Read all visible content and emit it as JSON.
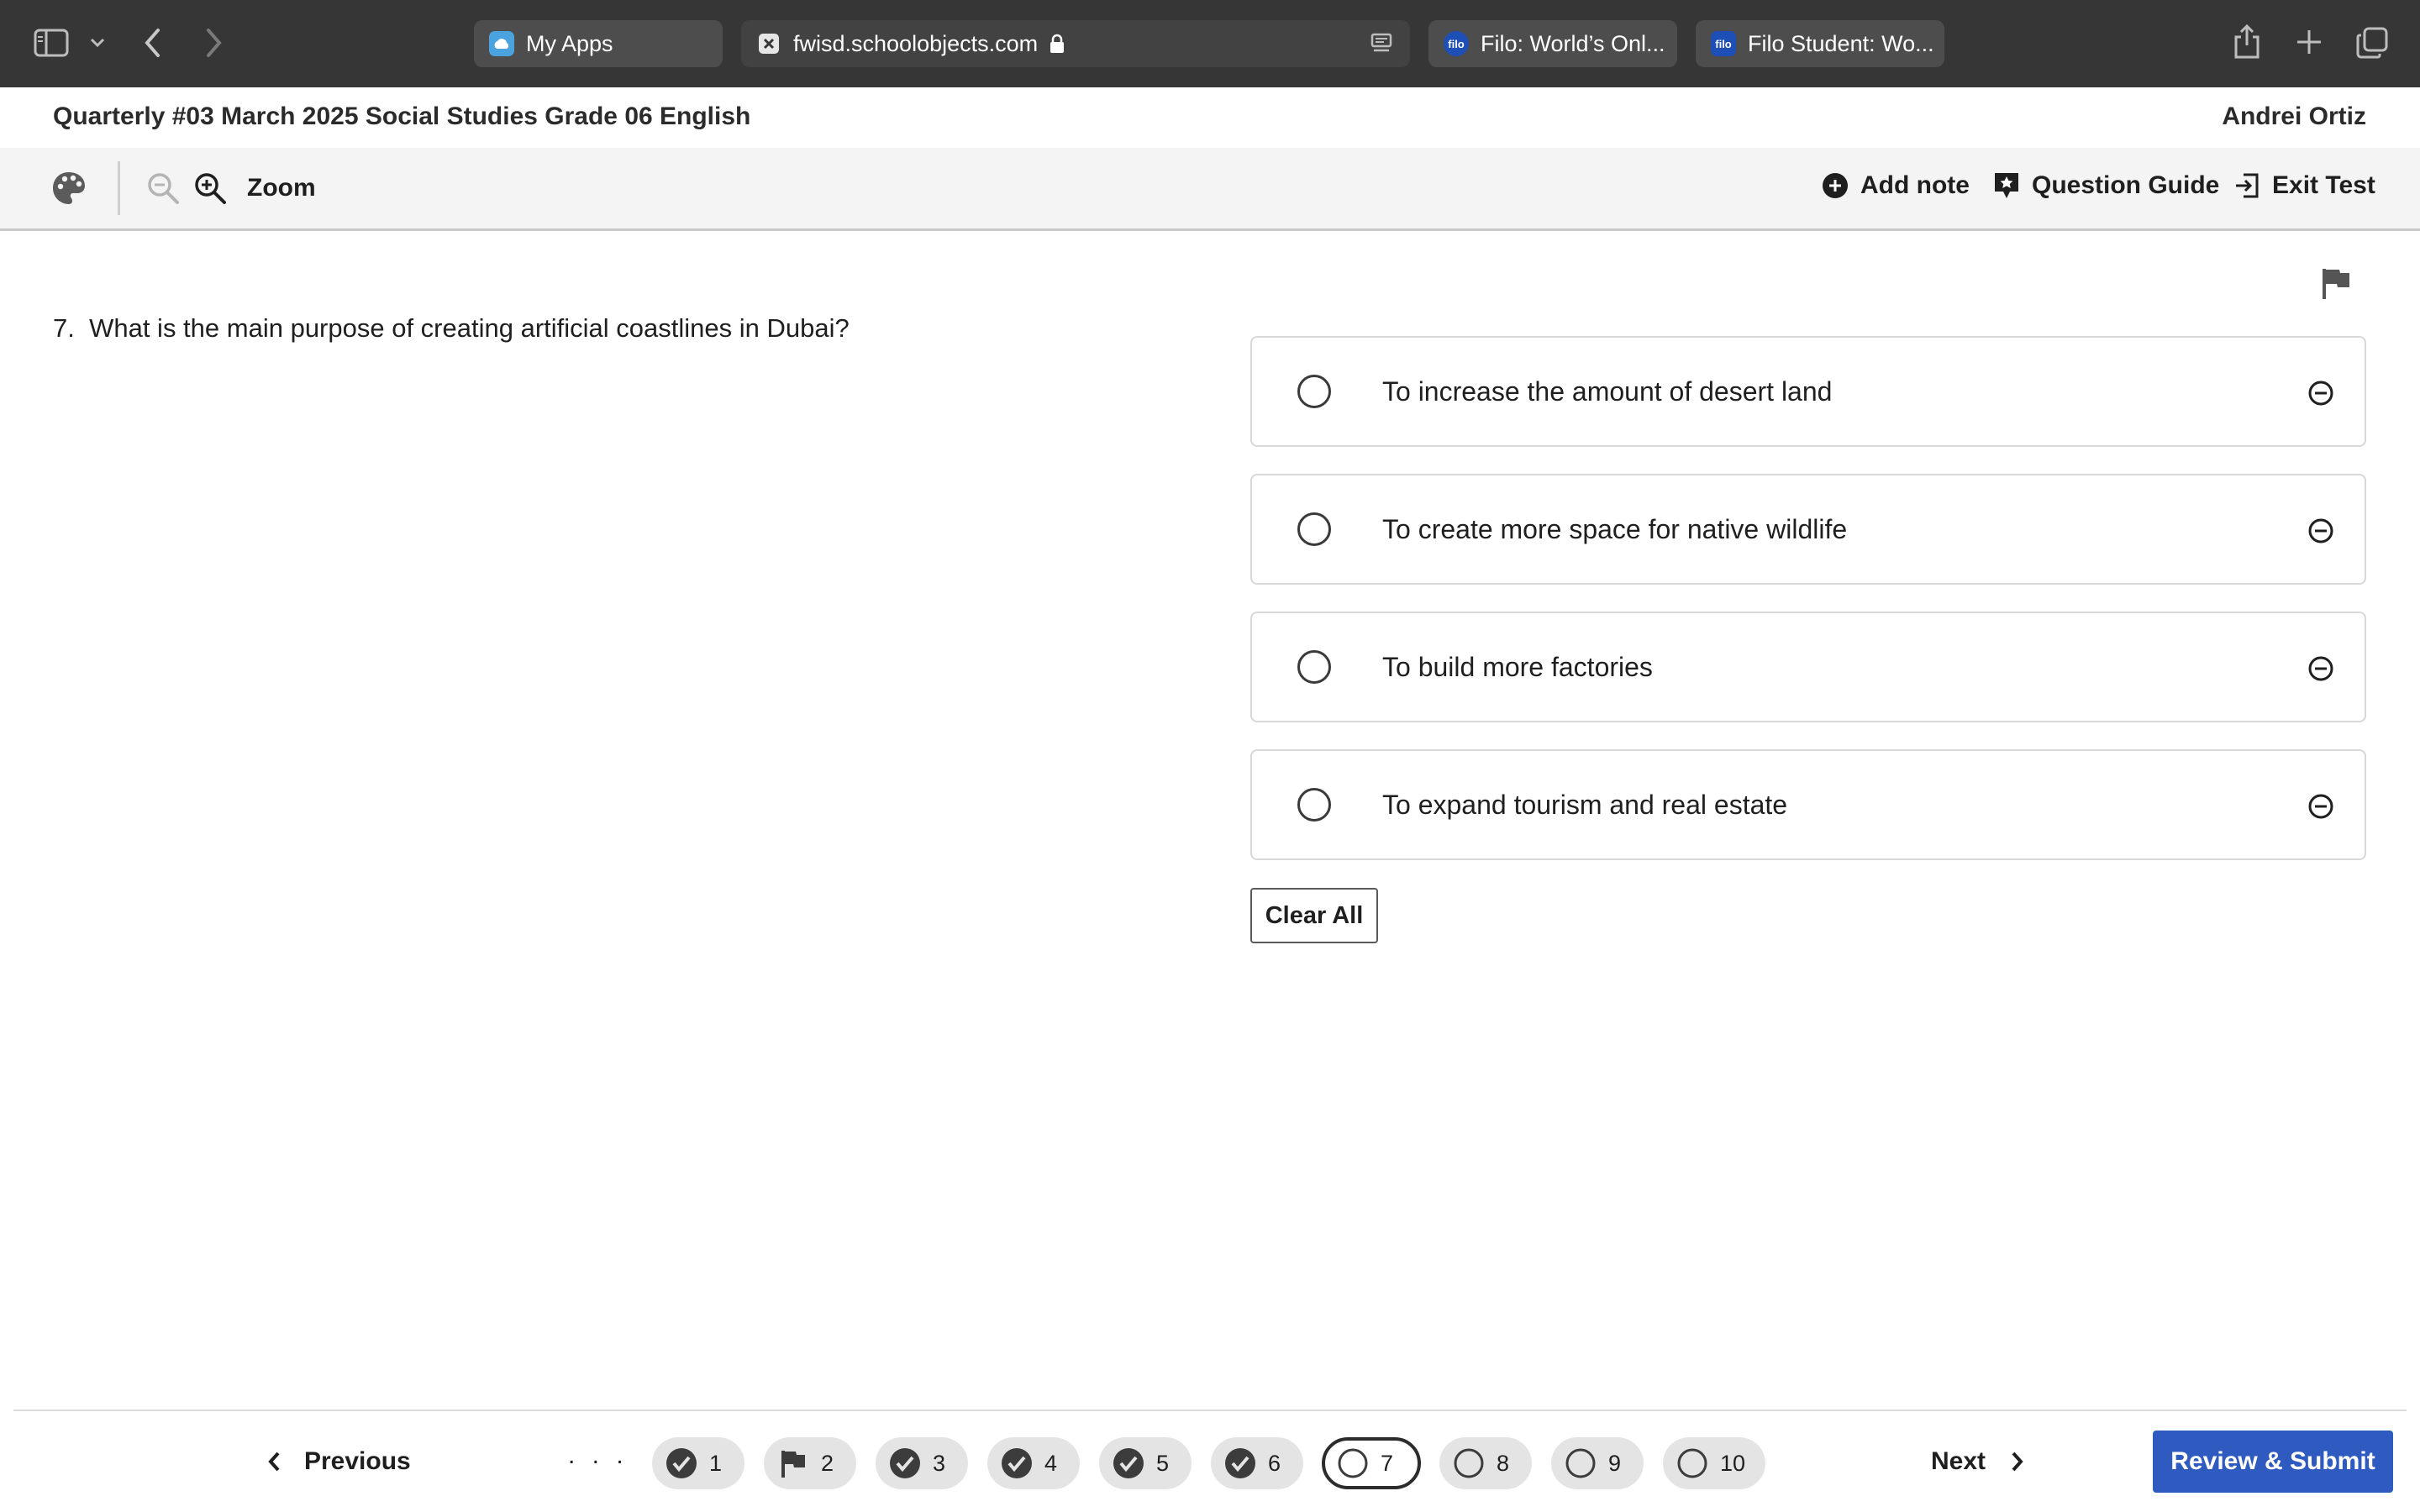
{
  "browser": {
    "tabs": [
      {
        "title": "My Apps",
        "favicon": "cloud-app-icon"
      },
      {
        "title": "fwisd.schoolobjects.com",
        "favicon": "close-x-icon",
        "lock": "lock-icon"
      },
      {
        "title": "Filo: World’s Onl...",
        "favicon": "filo-logo",
        "favicon_text": "filo"
      },
      {
        "title": "Filo Student: Wo...",
        "favicon": "filo-logo",
        "favicon_text": "filo"
      }
    ]
  },
  "header": {
    "title": "Quarterly #03 March 2025 Social Studies Grade 06 English",
    "student_name": "Andrei Ortiz"
  },
  "toolbar": {
    "zoom_label": "Zoom",
    "add_note_label": "Add note",
    "question_guide_label": "Question Guide",
    "exit_test_label": "Exit Test"
  },
  "question": {
    "number_text": "7.",
    "text": "What is the main purpose of creating artificial coastlines in Dubai?",
    "choices": [
      {
        "text": "To increase the amount of desert land",
        "selected": false
      },
      {
        "text": "To create more space for native wildlife",
        "selected": false
      },
      {
        "text": "To build more factories",
        "selected": false
      },
      {
        "text": "To expand tourism and real estate",
        "selected": false
      }
    ],
    "clear_all_label": "Clear All"
  },
  "navigation": {
    "previous_label": "Previous",
    "next_label": "Next",
    "ellipsis": ". . .",
    "review_submit_label": "Review & Submit",
    "questions": [
      {
        "number": "1",
        "status": "answered"
      },
      {
        "number": "2",
        "status": "flagged"
      },
      {
        "number": "3",
        "status": "answered"
      },
      {
        "number": "4",
        "status": "answered"
      },
      {
        "number": "5",
        "status": "answered"
      },
      {
        "number": "6",
        "status": "answered"
      },
      {
        "number": "7",
        "status": "current"
      },
      {
        "number": "8",
        "status": "unanswered"
      },
      {
        "number": "9",
        "status": "unanswered"
      },
      {
        "number": "10",
        "status": "unanswered"
      }
    ]
  },
  "colors": {
    "browser_chrome": "#363636",
    "primary_button": "#2f5bc1",
    "toolbar_bg": "#f4f4f4"
  }
}
